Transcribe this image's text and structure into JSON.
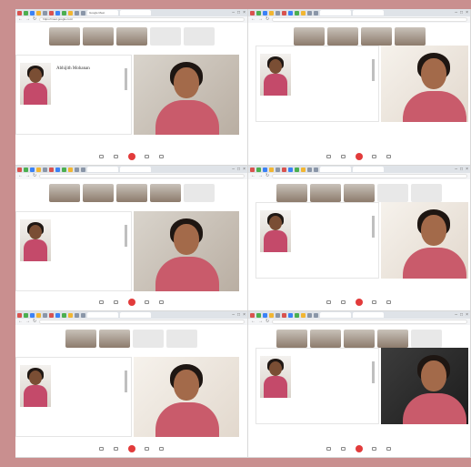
{
  "collage_title": "",
  "panels": [
    {
      "tabs": [
        "Google Meet",
        ""
      ],
      "url": "https://meet.google.com/",
      "strip": [
        "",
        "",
        ""
      ],
      "strip_names": [
        "",
        ""
      ],
      "caption": "",
      "slide_name": "Abhijith Mohanan",
      "slide_role": "",
      "toolbar": [
        "",
        "",
        "",
        ""
      ]
    },
    {
      "tabs": [
        "",
        ""
      ],
      "url": "",
      "strip": [
        "",
        "",
        "",
        ""
      ],
      "strip_names": [],
      "caption": "",
      "slide_name": "",
      "slide_role": "",
      "toolbar": [
        "",
        "",
        "",
        ""
      ]
    },
    {
      "tabs": [
        "",
        ""
      ],
      "url": "",
      "strip": [
        "",
        "",
        "",
        ""
      ],
      "strip_names": [
        ""
      ],
      "caption": "",
      "slide_name": "",
      "slide_role": "",
      "toolbar": [
        "",
        "",
        "",
        ""
      ]
    },
    {
      "tabs": [
        "",
        ""
      ],
      "url": "",
      "strip": [
        "",
        "",
        ""
      ],
      "strip_names": [
        "",
        ""
      ],
      "caption": "",
      "slide_name": "",
      "slide_role": "",
      "toolbar": [
        "",
        "",
        "",
        ""
      ]
    },
    {
      "tabs": [
        "",
        ""
      ],
      "url": "",
      "strip": [
        "",
        ""
      ],
      "strip_names": [
        "",
        ""
      ],
      "caption": "",
      "slide_name": "",
      "slide_role": "",
      "toolbar": [
        "",
        "",
        "",
        ""
      ]
    },
    {
      "tabs": [
        "",
        ""
      ],
      "url": "",
      "strip": [
        "",
        "",
        "",
        ""
      ],
      "strip_names": [
        ""
      ],
      "caption": "",
      "slide_name": "",
      "slide_role": "",
      "toolbar": [
        "",
        "",
        "",
        ""
      ]
    }
  ],
  "colors": {
    "background": "#c98f8f",
    "leave_button": "#e23b3b"
  },
  "icons": [
    "back-icon",
    "forward-icon",
    "reload-icon",
    "close-icon",
    "minimize-icon",
    "leave-call-icon",
    "mic-icon",
    "camera-icon"
  ]
}
